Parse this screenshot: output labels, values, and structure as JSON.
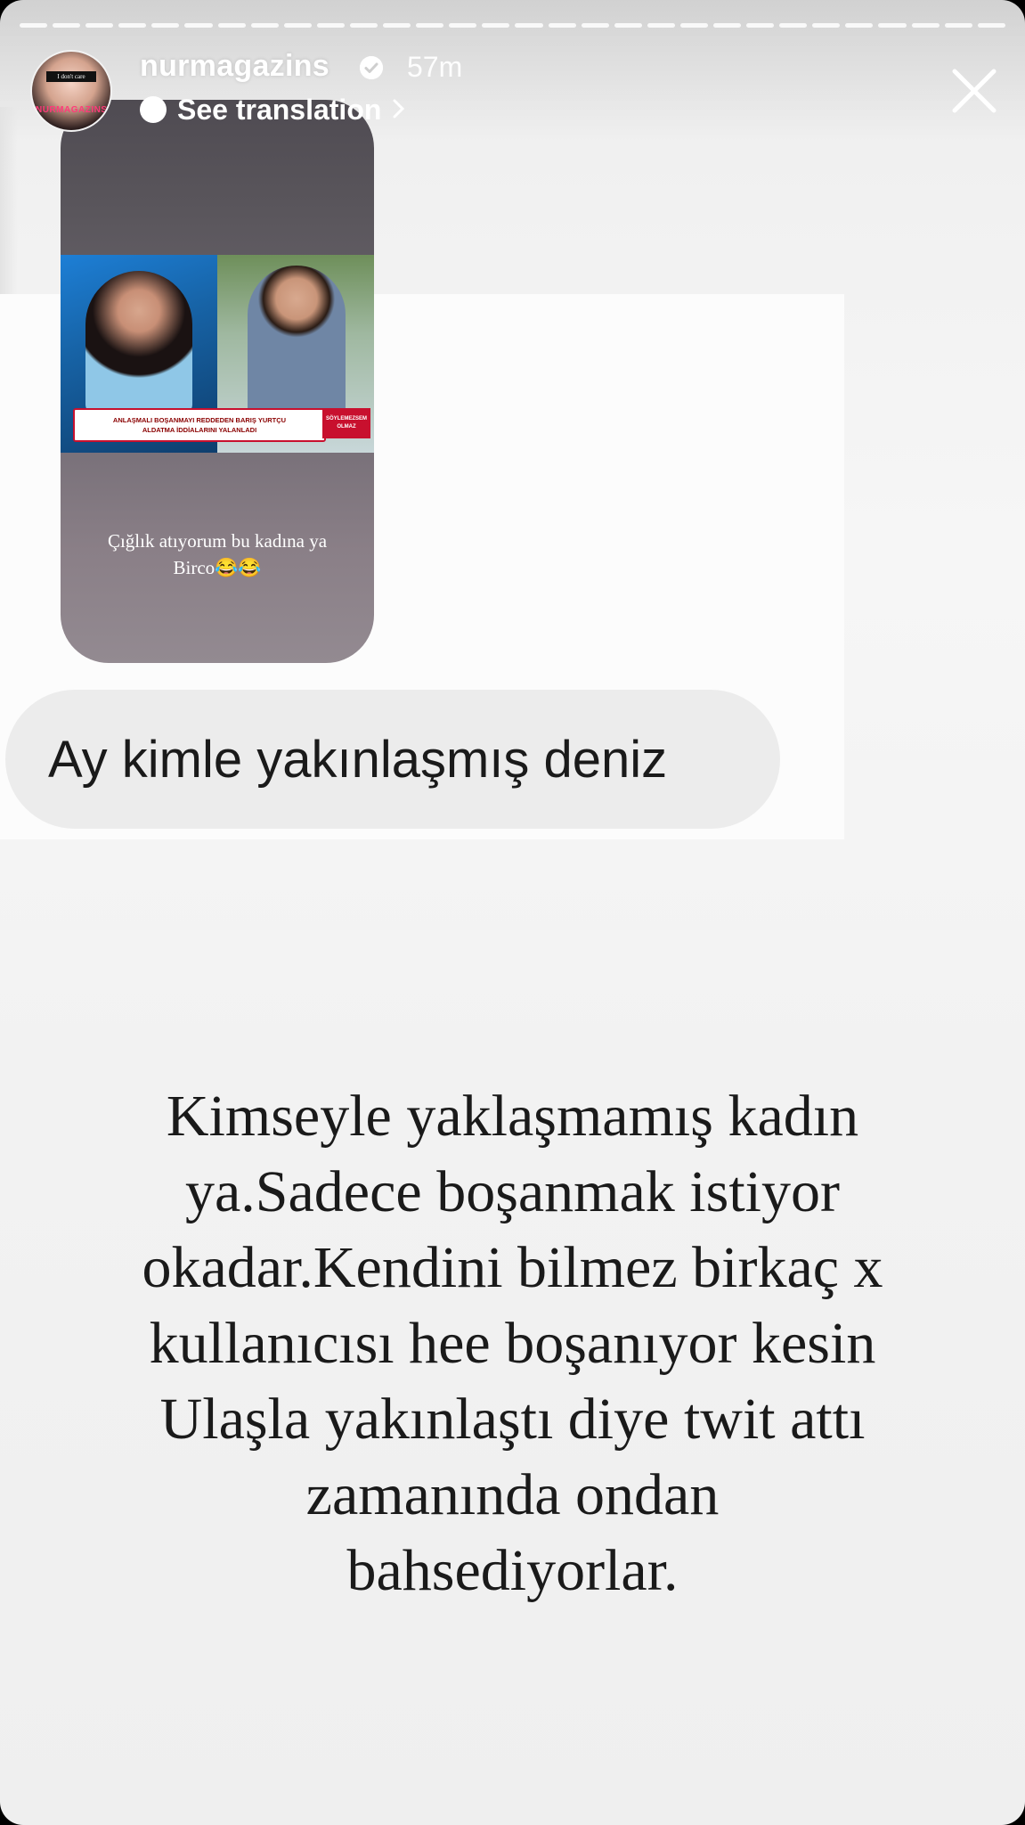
{
  "header": {
    "username": "nurmagazins",
    "time": "57m",
    "see_translation": "See translation",
    "progress_segments": 30,
    "avatar": {
      "band_text": "I don't care",
      "brand_text": "NURMAGAZINS"
    }
  },
  "shared_post": {
    "tv_headline_line1": "ANLAŞMALI BOŞANMAYI REDDEDEN BARIŞ YURTÇU",
    "tv_headline_line2": "ALDATMA İDDİALARINI YALANLADI",
    "tv_badge_line1": "SÖYLEMEZSEM",
    "tv_badge_line2": "OLMAZ",
    "caption_line1": "Çığlık atıyorum bu kadına ya",
    "caption_line2": "Birco😂😂"
  },
  "message_bubble": "Ay kimle yakınlaşmış deniz",
  "story_caption": {
    "lines": [
      "Kimseyle yaklaşmamış kadın",
      "ya.Sadece boşanmak istiyor",
      "okadar.Kendini bilmez birkaç x",
      "kullanıcısı hee boşanıyor kesin",
      "Ulaşla yakınlaştı diye twit attı",
      "zamanında  ondan",
      "bahsediyorlar."
    ]
  },
  "icons": {
    "verified": "verified-badge-icon",
    "close": "close-icon",
    "globe": "translate-globe-icon",
    "chevron": "chevron-right-icon"
  },
  "colors": {
    "verified_badge": "#ffffff",
    "tv_accent": "#c8102e"
  }
}
